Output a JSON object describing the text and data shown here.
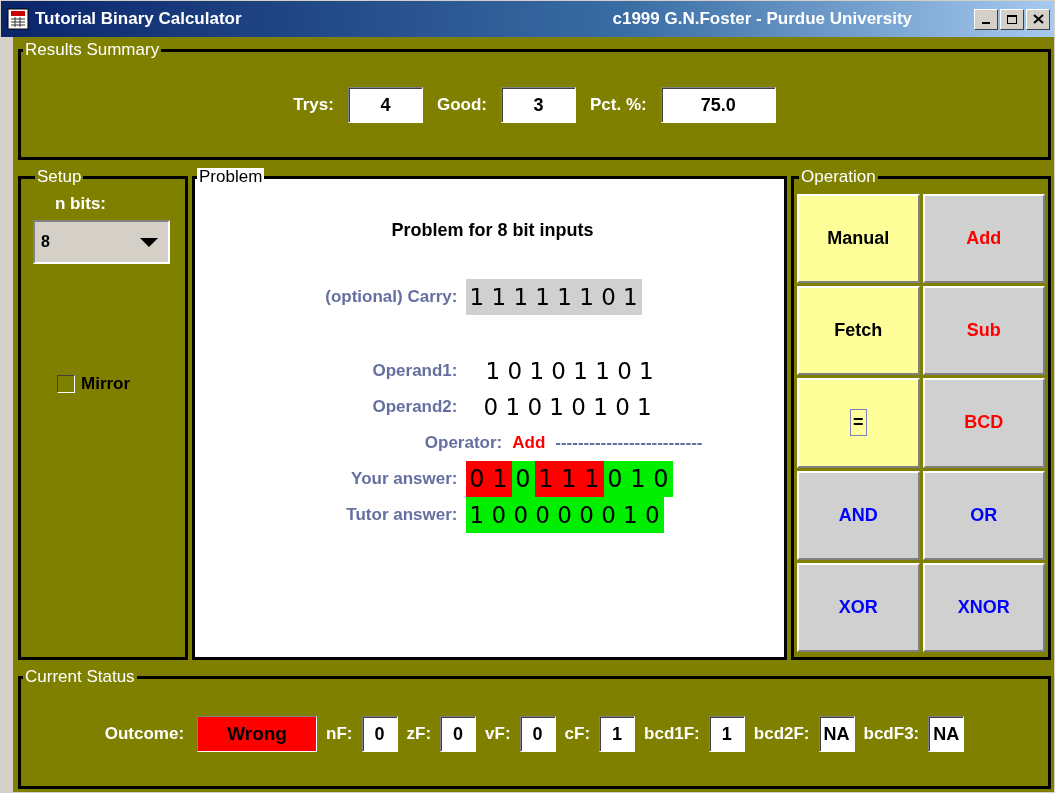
{
  "window": {
    "title": "Tutorial Binary Calculator",
    "credit": "c1999 G.N.Foster - Purdue University"
  },
  "results_summary": {
    "title": "Results Summary",
    "fields": [
      {
        "label": "Trys:",
        "value": "4"
      },
      {
        "label": "Good:",
        "value": "3"
      },
      {
        "label": "Pct. %:",
        "value": "75.0"
      }
    ]
  },
  "setup": {
    "title": "Setup",
    "n_bits_label": "n bits:",
    "n_bits_value": "8",
    "mirror": {
      "label": "Mirror",
      "checked": false
    }
  },
  "problem": {
    "title": "Problem",
    "heading": "Problem for 8 bit inputs",
    "carry": {
      "label": "(optional) Carry:",
      "value": "1 1 1 1 1 1 0 1"
    },
    "operand1": {
      "label": "Operand1:",
      "value": "1 0 1 0 1 1 0 1"
    },
    "operand2": {
      "label": "Operand2:",
      "value": "0 1 0 1 0 1 0 1"
    },
    "operator": {
      "label": "Operator:",
      "value": "Add",
      "rule": "--------------------------"
    },
    "your_answer": {
      "label": "Your answer:",
      "bits": [
        {
          "bit": "0",
          "correct": false
        },
        {
          "bit": "1",
          "correct": false
        },
        {
          "bit": "0",
          "correct": true
        },
        {
          "bit": "1",
          "correct": false
        },
        {
          "bit": "1",
          "correct": false
        },
        {
          "bit": "1",
          "correct": false
        },
        {
          "bit": "0",
          "correct": true
        },
        {
          "bit": "1",
          "correct": true
        },
        {
          "bit": "0",
          "correct": true
        }
      ]
    },
    "tutor_answer": {
      "label": "Tutor answer:",
      "value": "1 0 0 0 0 0 0 1 0"
    }
  },
  "operation": {
    "title": "Operation",
    "buttons": [
      {
        "label": "Manual",
        "kind": "mode",
        "focused": false
      },
      {
        "label": "Add",
        "kind": "arith",
        "focused": false
      },
      {
        "label": "Fetch",
        "kind": "mode",
        "focused": false
      },
      {
        "label": "Sub",
        "kind": "arith",
        "focused": false
      },
      {
        "label": "=",
        "kind": "mode",
        "focused": true
      },
      {
        "label": "BCD",
        "kind": "arith",
        "focused": false
      },
      {
        "label": "AND",
        "kind": "logic",
        "focused": false
      },
      {
        "label": "OR",
        "kind": "logic",
        "focused": false
      },
      {
        "label": "XOR",
        "kind": "logic",
        "focused": false
      },
      {
        "label": "XNOR",
        "kind": "logic",
        "focused": false
      }
    ]
  },
  "current_status": {
    "title": "Current Status",
    "outcome": {
      "label": "Outcome:",
      "value": "Wrong",
      "correct": false
    },
    "flags": [
      {
        "label": "nF:",
        "value": "0"
      },
      {
        "label": "zF:",
        "value": "0"
      },
      {
        "label": "vF:",
        "value": "0"
      },
      {
        "label": "cF:",
        "value": "1"
      },
      {
        "label": "bcd1F:",
        "value": "1"
      },
      {
        "label": "bcd2F:",
        "value": "NA"
      },
      {
        "label": "bcdF3:",
        "value": "NA"
      }
    ]
  }
}
